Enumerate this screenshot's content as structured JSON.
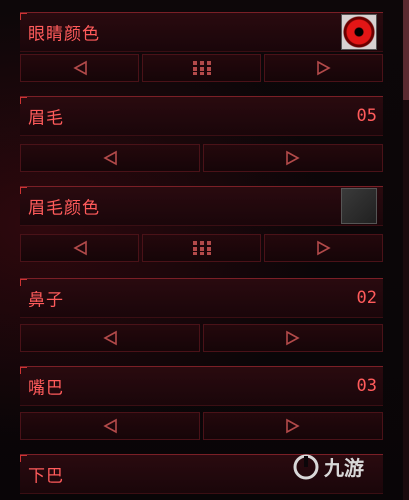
{
  "rows": [
    {
      "label": "眼睛颜色",
      "kind": "color",
      "swatch_color": "#e31616",
      "has_grid": true
    },
    {
      "label": "眉毛",
      "kind": "number",
      "value": "05",
      "has_grid": false
    },
    {
      "label": "眉毛颜色",
      "kind": "color",
      "swatch_color": "#2f2f2f",
      "has_grid": true
    },
    {
      "label": "鼻子",
      "kind": "number",
      "value": "02",
      "has_grid": false
    },
    {
      "label": "嘴巴",
      "kind": "number",
      "value": "03",
      "has_grid": false
    },
    {
      "label": "下巴",
      "kind": "number",
      "value": "",
      "has_grid": false
    }
  ],
  "watermark": {
    "text": "九游"
  },
  "colors": {
    "accent": "#ff5b5b",
    "border": "#7a1f26"
  }
}
